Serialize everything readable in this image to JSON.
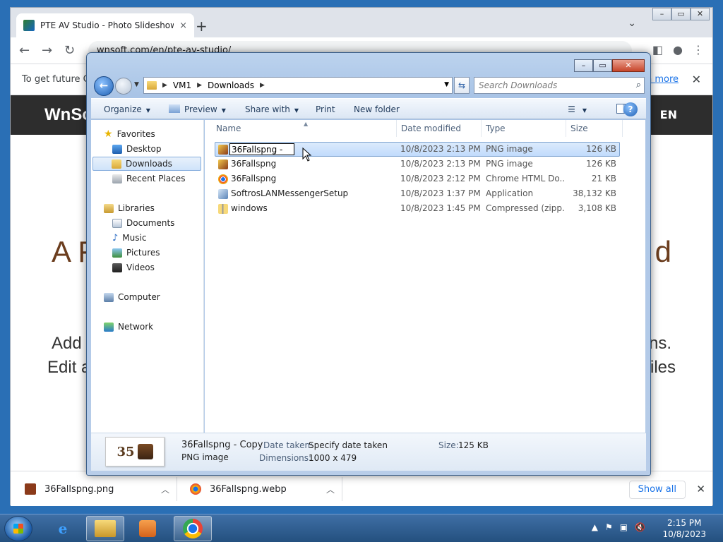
{
  "browser": {
    "tab_title": "PTE AV Studio - Photo Slideshow",
    "tab_close": "×",
    "new_tab": "+",
    "tab_dropdown": "⌄",
    "address": "wnsoft.com/en/pte-av-studio/",
    "infobar_text": "To get future Go",
    "infobar_link": "n more",
    "infobar_close": "✕",
    "site_logo": "WnSo",
    "site_lang": "EN",
    "hero_left": "A F",
    "hero_right": "d",
    "sub_line1_left": "Add",
    "sub_line2_left": "Edit a",
    "sub_line1_right": "ns.",
    "sub_line2_right": "iles",
    "downloads": [
      {
        "name": "36Fallspng.png",
        "color": "#8b3a1a"
      },
      {
        "name": "36Fallspng.webp",
        "color": "#1a73e8"
      }
    ],
    "show_all": "Show all",
    "download_close": "✕"
  },
  "dialog": {
    "path": [
      "VM1",
      "Downloads"
    ],
    "search_placeholder": "Search Downloads",
    "commands": {
      "organize": "Organize",
      "preview": "Preview",
      "share_with": "Share with",
      "print": "Print",
      "new_folder": "New folder",
      "help": "?"
    },
    "nav": {
      "favorites": "Favorites",
      "desktop": "Desktop",
      "downloads": "Downloads",
      "recent_places": "Recent Places",
      "libraries": "Libraries",
      "documents": "Documents",
      "music": "Music",
      "pictures": "Pictures",
      "videos": "Videos",
      "computer": "Computer",
      "network": "Network"
    },
    "columns": {
      "name": "Name",
      "date_modified": "Date modified",
      "type": "Type",
      "size": "Size"
    },
    "files": [
      {
        "name": "36Fallspng -",
        "date": "10/8/2023 2:13 PM",
        "type": "PNG image",
        "size": "126 KB",
        "icon": "image-icon"
      },
      {
        "name": "36Fallspng",
        "date": "10/8/2023 2:13 PM",
        "type": "PNG image",
        "size": "126 KB",
        "icon": "image-icon"
      },
      {
        "name": "36Fallspng",
        "date": "10/8/2023 2:12 PM",
        "type": "Chrome HTML Do...",
        "size": "21 KB",
        "icon": "chrome-icon"
      },
      {
        "name": "SoftrosLANMessengerSetup",
        "date": "10/8/2023 1:37 PM",
        "type": "Application",
        "size": "38,132 KB",
        "icon": "installer-icon"
      },
      {
        "name": "windows",
        "date": "10/8/2023 1:45 PM",
        "type": "Compressed (zipp...",
        "size": "3,108 KB",
        "icon": "zip-folder-icon"
      }
    ],
    "details": {
      "thumb_text": "35",
      "file_name": "36Fallspng - Copy",
      "file_type": "PNG image",
      "date_taken_label": "Date taken:",
      "date_taken_value": "Specify date taken",
      "dimensions_label": "Dimensions:",
      "dimensions_value": "1000 x 479",
      "size_label": "Size:",
      "size_value": "125 KB"
    }
  },
  "taskbar": {
    "time": "2:15 PM",
    "date": "10/8/2023"
  }
}
